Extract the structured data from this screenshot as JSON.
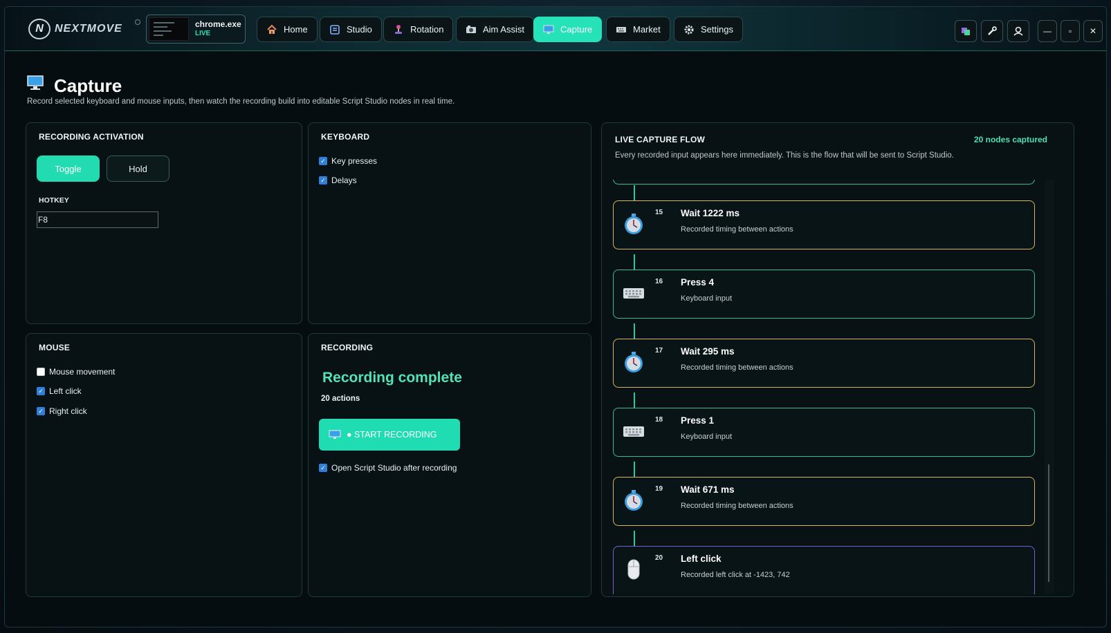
{
  "app": {
    "logo_text": "NEXTMOVE",
    "logo_mark": "N",
    "process": {
      "name": "chrome.exe",
      "status": "LIVE"
    }
  },
  "nav": {
    "tabs": [
      {
        "label": "Home",
        "icon": "house-icon",
        "active": false
      },
      {
        "label": "Studio",
        "icon": "studio-icon",
        "active": false
      },
      {
        "label": "Rotation",
        "icon": "joystick-icon",
        "active": false
      },
      {
        "label": "Aim Assist",
        "icon": "camera-icon",
        "active": false
      },
      {
        "label": "Capture",
        "icon": "monitor-icon",
        "active": true
      },
      {
        "label": "Market",
        "icon": "keyboard-icon",
        "active": false
      },
      {
        "label": "Settings",
        "icon": "gear-icon",
        "active": false
      }
    ]
  },
  "window_controls": {
    "minimize": "—",
    "maximize": "▫",
    "close": "✕"
  },
  "page": {
    "title": "Capture",
    "subtitle": "Record selected keyboard and mouse inputs, then watch the recording build into editable Script Studio nodes in real time."
  },
  "activation": {
    "title": "RECORDING ACTIVATION",
    "toggle_label": "Toggle",
    "hold_label": "Hold",
    "selected_mode": "Toggle",
    "hotkey_label": "HOTKEY",
    "hotkey_value": "F8"
  },
  "keyboard": {
    "title": "KEYBOARD",
    "options": [
      {
        "label": "Key presses",
        "checked": true
      },
      {
        "label": "Delays",
        "checked": true
      }
    ]
  },
  "mouse": {
    "title": "MOUSE",
    "options": [
      {
        "label": "Mouse movement",
        "checked": false
      },
      {
        "label": "Left click",
        "checked": true
      },
      {
        "label": "Right click",
        "checked": true
      }
    ]
  },
  "recording": {
    "title": "RECORDING",
    "status": "Recording complete",
    "count": "20 actions",
    "start_label": "● START RECORDING",
    "open_studio_label": "Open Script Studio after recording",
    "open_studio_checked": true
  },
  "flow": {
    "title": "LIVE CAPTURE FLOW",
    "count": "20 nodes captured",
    "subtitle": "Every recorded input appears here immediately. This is the flow that will be sent to Script Studio.",
    "nodes": [
      {
        "num": "15",
        "kind": "wait",
        "icon": "stopwatch-icon",
        "title": "Wait 1222 ms",
        "desc": "Recorded timing between actions"
      },
      {
        "num": "16",
        "kind": "key",
        "icon": "keyboard-icon",
        "title": "Press 4",
        "desc": "Keyboard input"
      },
      {
        "num": "17",
        "kind": "wait",
        "icon": "stopwatch-icon",
        "title": "Wait 295 ms",
        "desc": "Recorded timing between actions"
      },
      {
        "num": "18",
        "kind": "key",
        "icon": "keyboard-icon",
        "title": "Press 1",
        "desc": "Keyboard input"
      },
      {
        "num": "19",
        "kind": "wait",
        "icon": "stopwatch-icon",
        "title": "Wait 671 ms",
        "desc": "Recorded timing between actions"
      },
      {
        "num": "20",
        "kind": "click",
        "icon": "mouse-icon",
        "title": "Left click",
        "desc": "Recorded left click at -1423, 742"
      }
    ]
  },
  "colors": {
    "accent": "#22dbb1",
    "wait_border": "#d7b45a",
    "key_border": "#3fb89a",
    "click_border": "#7b5fd1",
    "checkbox": "#2f80d8"
  }
}
